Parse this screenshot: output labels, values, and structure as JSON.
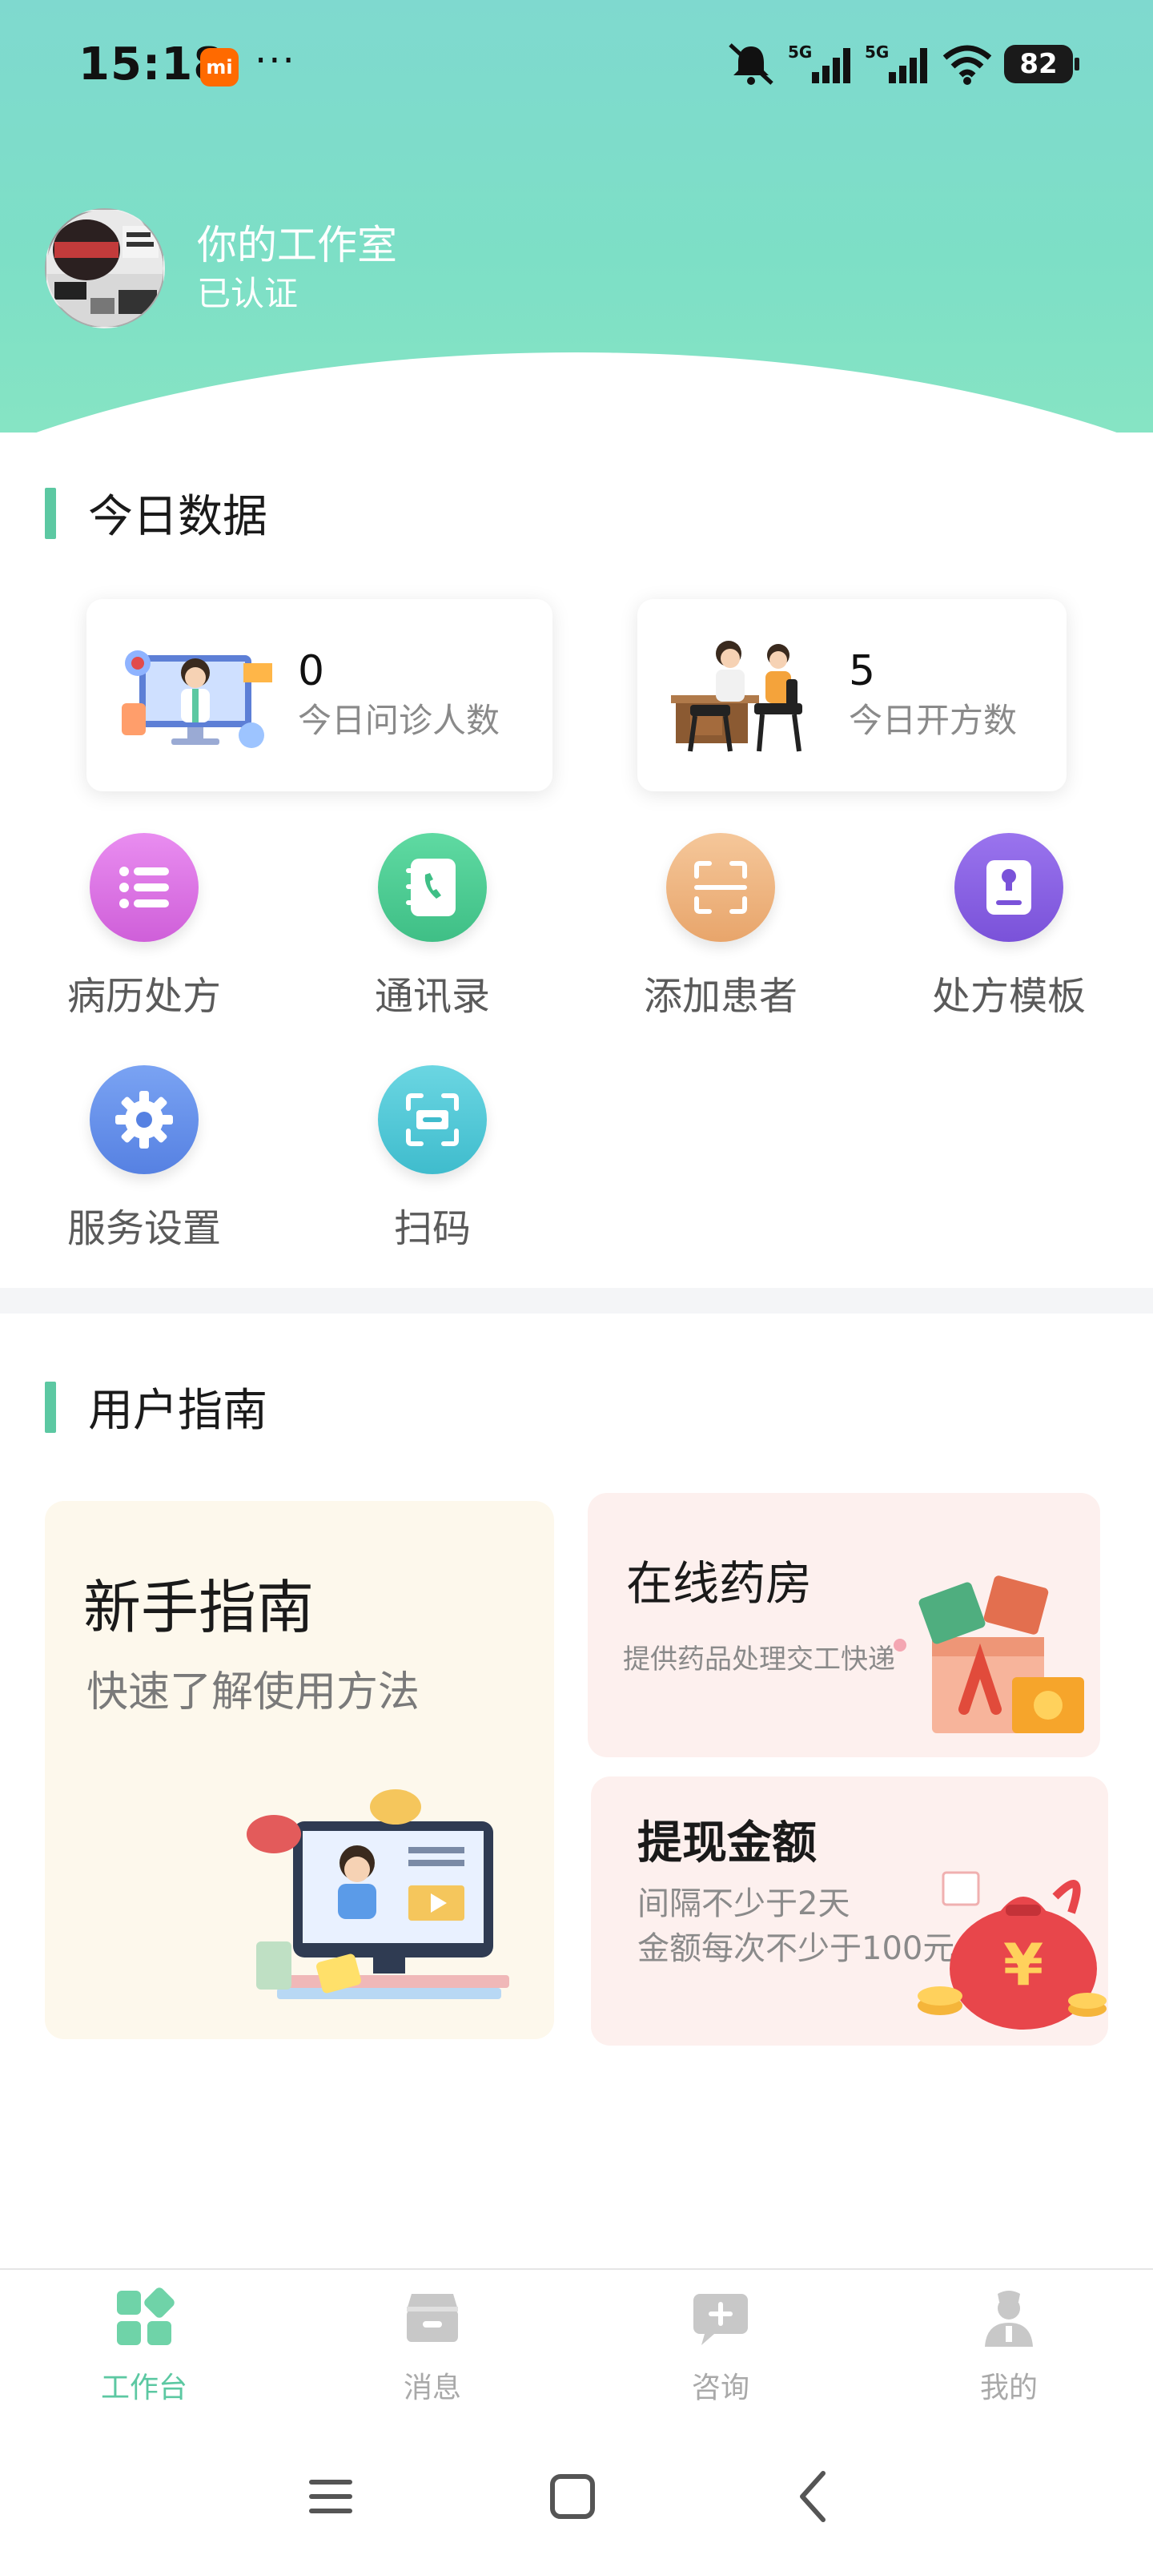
{
  "status_bar": {
    "time": "15:18",
    "carrier_badge": "mi",
    "more": "···",
    "battery": "82",
    "network1": "5G",
    "network2": "5G"
  },
  "profile": {
    "name": "你的工作室",
    "status": "已认证"
  },
  "today": {
    "title": "今日数据",
    "stats": [
      {
        "value": "0",
        "label": "今日问诊人数"
      },
      {
        "value": "5",
        "label": "今日开方数"
      }
    ]
  },
  "actions": [
    {
      "label": "病历处方",
      "icon": "list-icon",
      "color": "#d86ee0"
    },
    {
      "label": "通讯录",
      "icon": "phone-book-icon",
      "color": "#4fcf93"
    },
    {
      "label": "添加患者",
      "icon": "scan-frame-icon",
      "color": "#efb27e"
    },
    {
      "label": "处方模板",
      "icon": "notebook-icon",
      "color": "#8a62e3"
    },
    {
      "label": "服务设置",
      "icon": "gear-icon",
      "color": "#5f8cea"
    },
    {
      "label": "扫码",
      "icon": "scan-icon",
      "color": "#49c7d6"
    }
  ],
  "guide": {
    "title": "用户指南",
    "newbie": {
      "title": "新手指南",
      "subtitle": "快速了解使用方法"
    },
    "pharmacy": {
      "title": "在线药房",
      "subtitle": "提供药品处理交工快递"
    },
    "withdraw": {
      "title": "提现金额",
      "line1": "间隔不少于2天",
      "line2": "金额每次不少于100元"
    }
  },
  "bottom_nav": [
    {
      "label": "工作台",
      "icon": "workbench-icon",
      "active": true
    },
    {
      "label": "消息",
      "icon": "message-icon",
      "active": false
    },
    {
      "label": "咨询",
      "icon": "consult-icon",
      "active": false
    },
    {
      "label": "我的",
      "icon": "doctor-profile-icon",
      "active": false
    }
  ],
  "colors": {
    "accent": "#5cc8a2",
    "header_start": "#7fd9cf",
    "header_end": "#86e4c4"
  }
}
